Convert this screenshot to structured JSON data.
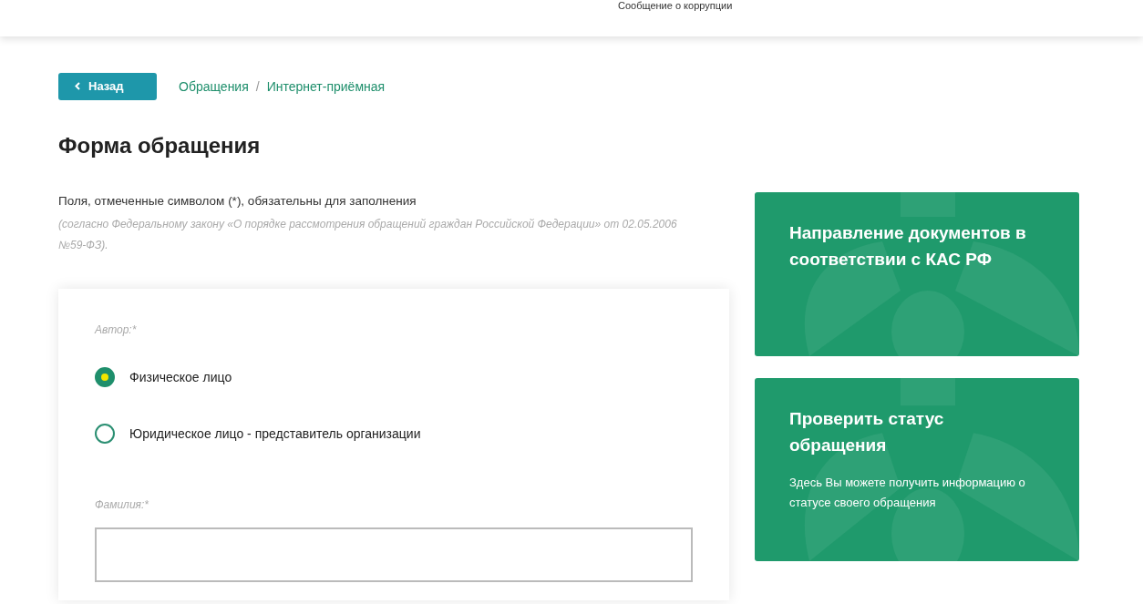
{
  "header": {
    "link": "Сообщение о коррупции"
  },
  "back_button": {
    "label": "Назад"
  },
  "breadcrumb_separator": "/",
  "breadcrumbs": [
    {
      "label": "Обращения"
    },
    {
      "label": "Интернет-приёмная"
    }
  ],
  "page_title": "Форма обращения",
  "required_note": "Поля, отмеченные символом (*), обязательны для заполнения",
  "law_note": "(согласно Федеральному закону «О порядке рассмотрения обращений граждан Российской Федерации» от 02.05.2006 №59-ФЗ).",
  "form": {
    "author_label": "Автор:*",
    "author_options": [
      {
        "label": "Физическое лицо",
        "selected": true
      },
      {
        "label": "Юридическое лицо - представитель организации",
        "selected": false
      }
    ],
    "surname_label": "Фамилия:*"
  },
  "side_cards": [
    {
      "title": "Направление документов в соответствии с КАС РФ"
    },
    {
      "title": "Проверить статус обращения",
      "text": "Здесь Вы можете получить информацию о статусе своего обращения"
    }
  ]
}
